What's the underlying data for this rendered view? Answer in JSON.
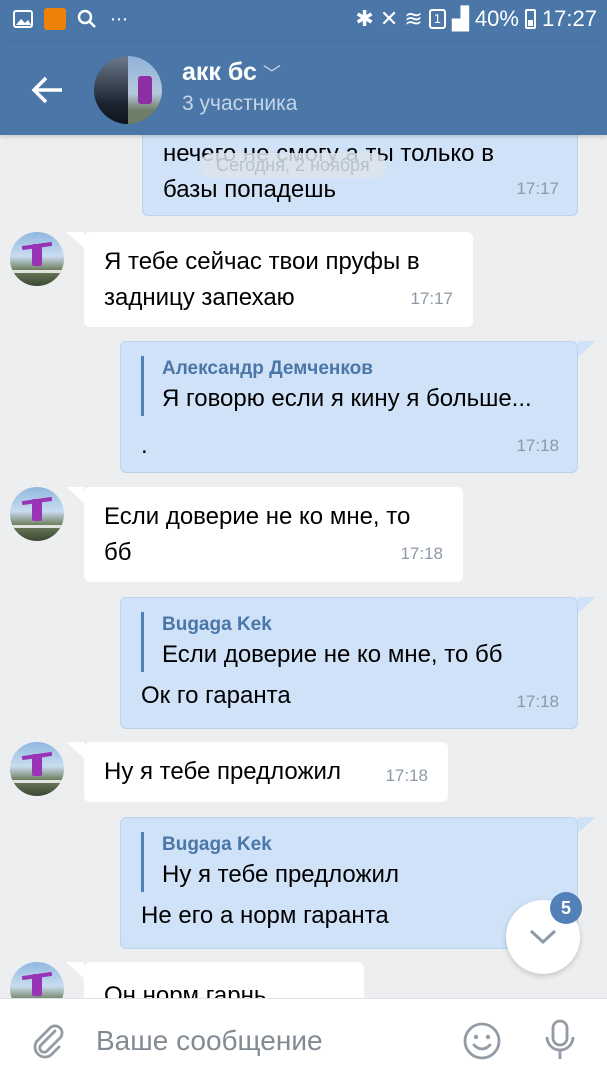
{
  "status_bar": {
    "battery": "40%",
    "time": "17:27",
    "sim": "1"
  },
  "header": {
    "title": "акк бс",
    "subtitle": "3 участника"
  },
  "date_separator": "Сегодня, 2 ноября",
  "messages": [
    {
      "direction": "out",
      "text_lines": [
        "нечего не смогу а ты только в",
        "базы попадешь"
      ],
      "time": "17:17"
    },
    {
      "direction": "in",
      "text_lines": [
        "Я тебе сейчас твои пруфы в",
        "задницу запехаю"
      ],
      "time": "17:17"
    },
    {
      "direction": "out",
      "quote_author": "Александр Демченков",
      "quote_text": "Я говорю если я кину я больше...",
      "text_lines": [
        "."
      ],
      "time": "17:18"
    },
    {
      "direction": "in",
      "text_lines": [
        "Если доверие не ко мне, то",
        "бб"
      ],
      "time": "17:18"
    },
    {
      "direction": "out",
      "quote_author": "Bugaga Kek",
      "quote_text": "Если доверие не ко мне, то бб",
      "text_lines": [
        "Ок го гаранта"
      ],
      "time": "17:18"
    },
    {
      "direction": "in",
      "text_lines": [
        "Ну я тебе предложил"
      ],
      "time": "17:18"
    },
    {
      "direction": "out",
      "quote_author": "Bugaga Kek",
      "quote_text": "Ну я тебе предложил",
      "text_lines": [
        "Не его а норм гаранта"
      ],
      "time": ""
    },
    {
      "direction": "in",
      "text_lines": [
        "Он норм гарнь"
      ],
      "time": ""
    }
  ],
  "scroll_button": {
    "unread_count": "5",
    "icon": "chevron-down-icon"
  },
  "composer": {
    "placeholder": "Ваше сообщение",
    "icons": [
      "attach-icon",
      "smile-icon",
      "mic-icon"
    ]
  },
  "colors": {
    "header": "#4a76a8",
    "outgoing_bubble": "#cfe2f7",
    "incoming_bubble": "#ffffff",
    "background": "#edeef0",
    "accent": "#5181b8"
  }
}
